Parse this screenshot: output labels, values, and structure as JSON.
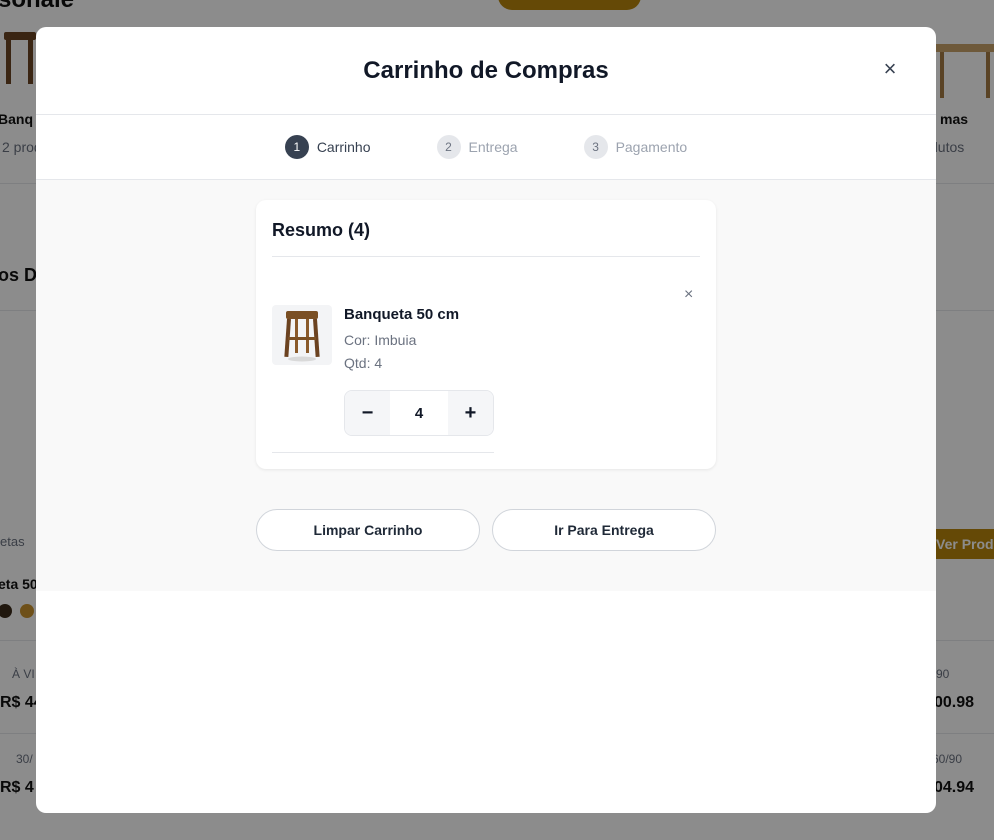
{
  "background": {
    "cards": [
      {
        "name": "Banq",
        "count": "2 prod"
      },
      {
        "name": "mas",
        "count": "dutos"
      }
    ],
    "section_title": "os Di",
    "label_left": "etas",
    "product_left": "eta 50",
    "gold_button": "Ver Produ",
    "payment_rows": [
      {
        "label_left": "À VI",
        "price_left": "R$ 44",
        "label_right": "90",
        "price_right": "00.98"
      },
      {
        "label_left": "30/",
        "price_left": "R$ 4",
        "label_right": "60/90",
        "price_right": "04.94"
      }
    ]
  },
  "modal": {
    "title": "Carrinho de Compras",
    "close_symbol": "×",
    "steps": [
      {
        "number": "1",
        "label": "Carrinho",
        "active": true
      },
      {
        "number": "2",
        "label": "Entrega",
        "active": false
      },
      {
        "number": "3",
        "label": "Pagamento",
        "active": false
      }
    ],
    "summary": {
      "title": "Resumo (4)",
      "items": [
        {
          "name": "Banqueta 50 cm",
          "color": "Cor: Imbuia",
          "qty_text": "Qtd: 4",
          "quantity": "4",
          "remove_symbol": "×",
          "minus_symbol": "−",
          "plus_symbol": "+"
        }
      ]
    },
    "actions": {
      "clear_label": "Limpar Carrinho",
      "next_label": "Ir Para Entrega"
    }
  },
  "colors": {
    "active_step": "#374151",
    "overlay": "rgba(0,0,0,0.45)",
    "content_bg": "#f9f9f9",
    "gold": "#b8860b"
  }
}
